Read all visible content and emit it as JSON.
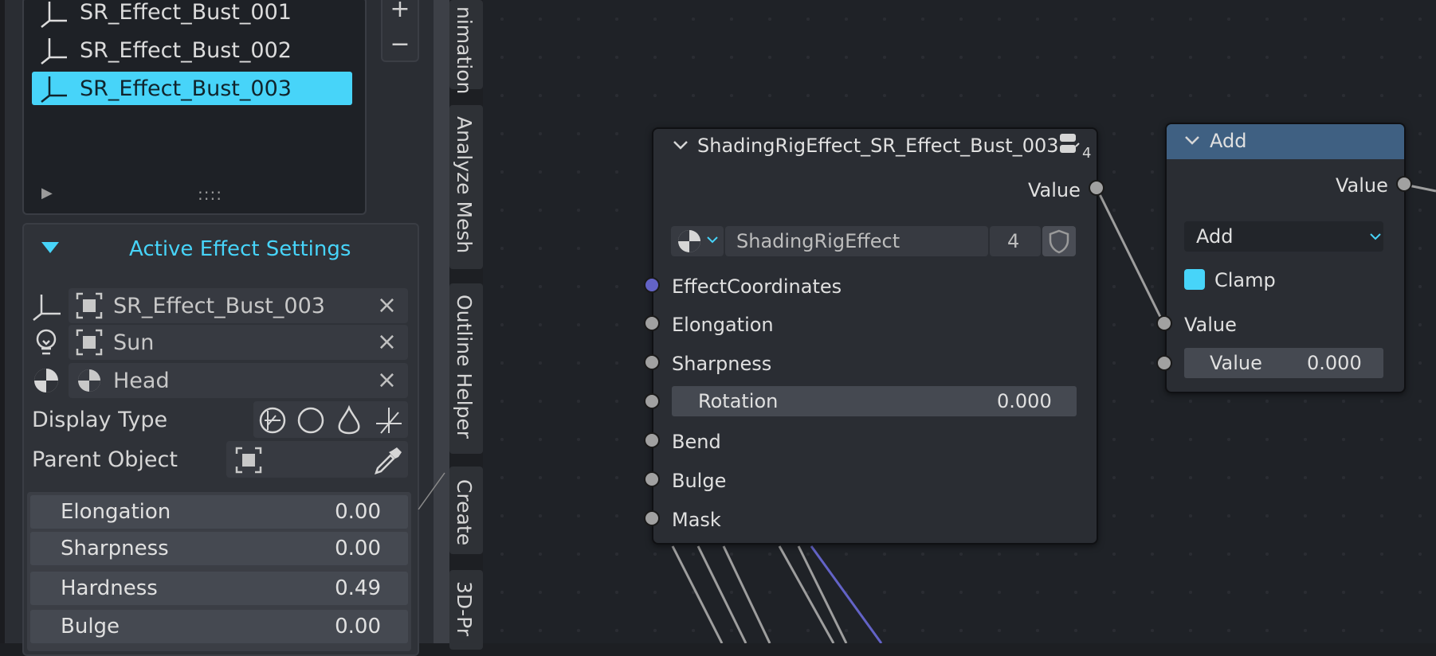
{
  "list": {
    "items": [
      {
        "label": "SR_Effect_Bust_001",
        "selected": false
      },
      {
        "label": "SR_Effect_Bust_002",
        "selected": false
      },
      {
        "label": "SR_Effect_Bust_003",
        "selected": true
      }
    ],
    "add_label": "+",
    "remove_label": "−",
    "grip": "::::"
  },
  "settings": {
    "title": "Active Effect Settings",
    "fields": [
      {
        "value": "SR_Effect_Bust_003",
        "type_icon": "empty-axes-icon",
        "obj_icon": "object-box-icon"
      },
      {
        "value": "Sun",
        "type_icon": "light-bulb-icon",
        "obj_icon": "object-box-icon"
      },
      {
        "value": "Head",
        "type_icon": "material-icon",
        "obj_icon": "material-icon"
      }
    ],
    "clear_label": "×",
    "display_type_label": "Display Type",
    "parent_object_label": "Parent Object",
    "sliders": [
      {
        "name": "Elongation",
        "value": "0.00"
      },
      {
        "name": "Sharpness",
        "value": "0.00"
      },
      {
        "name": "Hardness",
        "value": "0.49"
      },
      {
        "name": "Bulge",
        "value": "0.00"
      }
    ]
  },
  "tabs": [
    "nimation",
    "Analyze Mesh",
    "Outline Helper",
    "Create",
    "3D-Pr"
  ],
  "node_group": {
    "title": "ShadingRigEffect_SR_Effect_Bust_003",
    "users_badge": "4",
    "output_label": "Value",
    "datablock_name": "ShadingRigEffect",
    "datablock_users": "4",
    "inputs": [
      "EffectCoordinates",
      "Elongation",
      "Sharpness",
      "Rotation",
      "Bend",
      "Bulge",
      "Mask"
    ],
    "rotation_value": "0.000"
  },
  "math_node": {
    "title": "Add",
    "output_label": "Value",
    "operation": "Add",
    "clamp_label": "Clamp",
    "clamp_checked": true,
    "input1_label": "Value",
    "input2_label": "Value",
    "input2_value": "0.000"
  },
  "colors": {
    "accent": "#47d4f9",
    "math_header": "#3f6082",
    "purple_socket": "#6363c7",
    "socket_grey": "#a1a1a1"
  }
}
